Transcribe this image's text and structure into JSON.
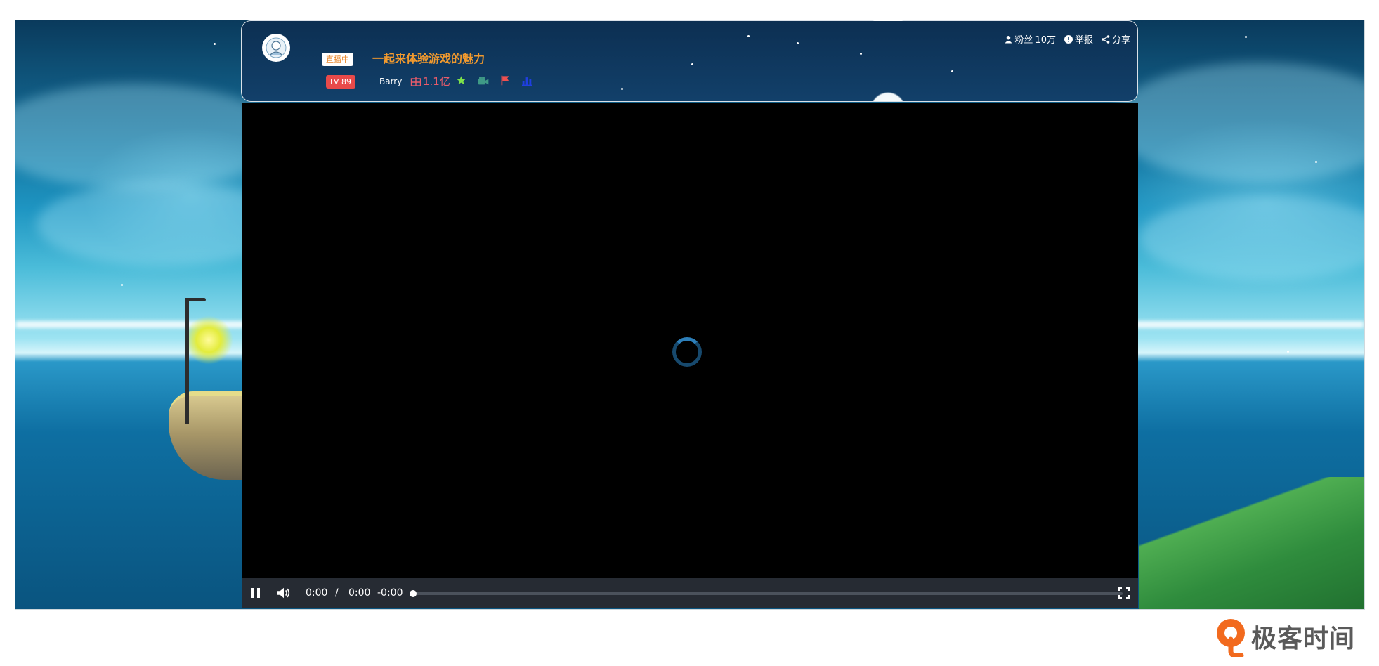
{
  "stream": {
    "live_badge": "直播中",
    "title": "一起来体验游戏的魅力",
    "level_badge": "LV 89",
    "username": "Barry",
    "popularity": "1.1亿"
  },
  "header_actions": {
    "fans_label": "粉丝",
    "fans_count": "10万",
    "report_label": "举报",
    "share_label": "分享"
  },
  "status_icons": [
    "star-icon",
    "camera-icon",
    "flag-icon",
    "chart-icon"
  ],
  "player": {
    "current_time": "0:00",
    "separator": "/",
    "duration": "0:00",
    "remaining": "-0:00",
    "progress": 0
  },
  "watermark": {
    "brand_text": "极客时间"
  },
  "colors": {
    "title": "#f29a2e",
    "live_badge_text": "#e8862a",
    "level_badge_bg": "#e84a4a",
    "popularity": "#e85c6b",
    "star": "#7ee24a",
    "camera": "#3f9a86",
    "flag": "#f05050",
    "chart": "#1f3fe0",
    "control_bar": "#262b33"
  }
}
